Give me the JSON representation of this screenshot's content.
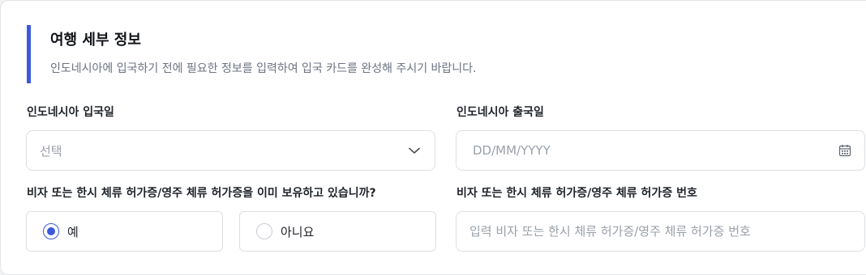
{
  "section": {
    "title": "여행 세부 정보",
    "description": "인도네시아에 입국하기 전에 필요한 정보를 입력하여 입국 카드를 완성해 주시기 바랍니다."
  },
  "arrival": {
    "label": "인도네시아 입국일",
    "placeholder": "선택",
    "icon": "chevron-down-icon"
  },
  "departure": {
    "label": "인도네시아 출국일",
    "placeholder": "DD/MM/YYYY",
    "icon": "calendar-icon"
  },
  "visa_question": {
    "label": "비자 또는 한시 체류 허가증/영주 체류 허가증을 이미 보유하고 있습니까?",
    "options": [
      {
        "label": "예",
        "checked": true
      },
      {
        "label": "아니요",
        "checked": false
      }
    ]
  },
  "visa_number": {
    "label": "비자 또는 한시 체류 허가증/영주 체류 허가증 번호",
    "placeholder": "입력 비자 또는 한시 체류 허가증/영주 체류 허가증 번호"
  },
  "colors": {
    "accent": "#3b5bdb",
    "border": "#dcdfe4",
    "placeholder": "#9aa0a8"
  }
}
